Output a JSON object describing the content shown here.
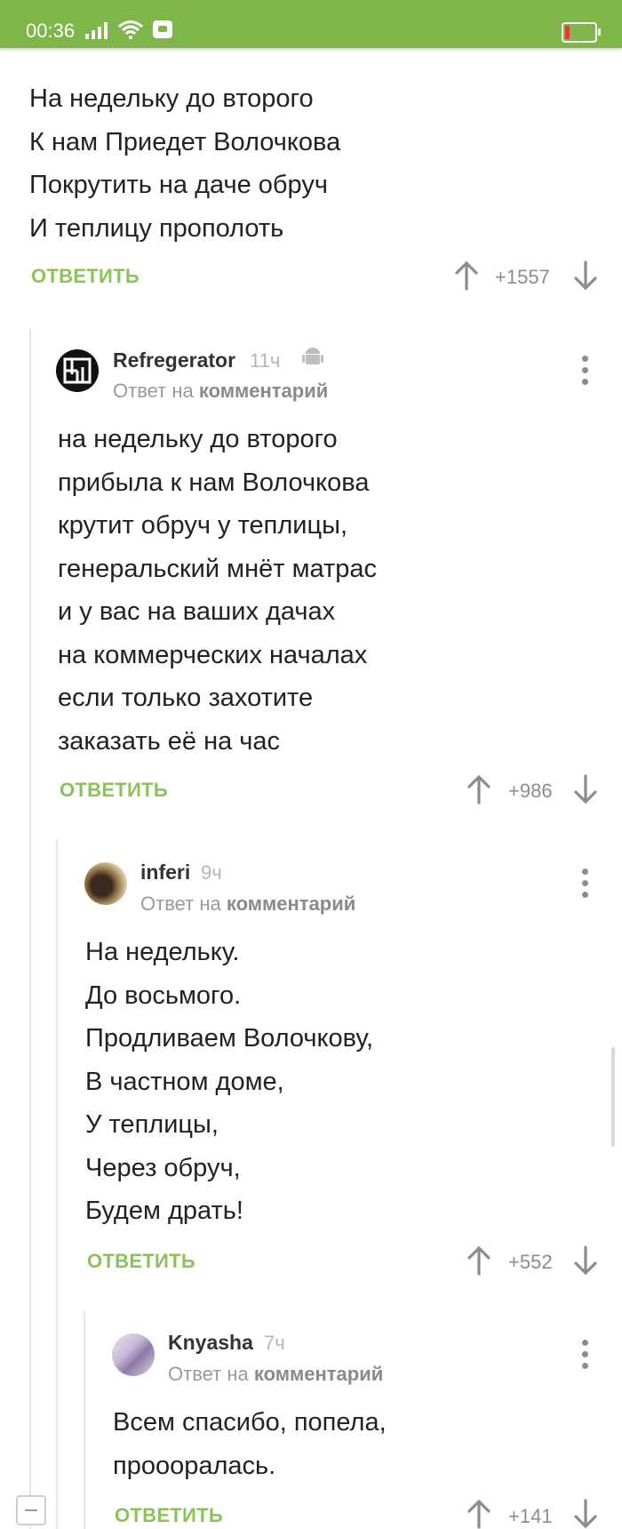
{
  "status_bar": {
    "time": "00:36"
  },
  "comments": [
    {
      "lines": [
        "На недельку до второго",
        "К нам Приедет Волочкова",
        "Покрутить на даче обруч",
        "И теплицу прополоть"
      ],
      "reply_label": "ОТВЕТИТЬ",
      "score": "+1557"
    },
    {
      "author": "Refregerator",
      "ago": "11ч",
      "reply_to_prefix": "Ответ на",
      "reply_to_link": "комментарий",
      "lines": [
        "на недельку до второго",
        "прибыла к нам Волочкова",
        "крутит обруч у теплицы,",
        "генеральский мнёт матрас",
        "и у вас на ваших дачах",
        "на коммерческих началах",
        "если только захотите",
        "заказать её на час"
      ],
      "reply_label": "ОТВЕТИТЬ",
      "score": "+986"
    },
    {
      "author": "inferi",
      "ago": "9ч",
      "reply_to_prefix": "Ответ на",
      "reply_to_link": "комментарий",
      "lines": [
        "На недельку.",
        "До восьмого.",
        "Продливаем Волочкову,",
        "В частном доме,",
        "У теплицы,",
        "Через обруч,",
        "Будем драть!"
      ],
      "reply_label": "ОТВЕТИТЬ",
      "score": "+552"
    },
    {
      "author": "Knyasha",
      "ago": "7ч",
      "reply_to_prefix": "Ответ на",
      "reply_to_link": "комментарий",
      "lines": [
        "Всем спасибо, попела,",
        "проооралась."
      ],
      "reply_label": "ОТВЕТИТЬ",
      "score": "+141"
    }
  ]
}
